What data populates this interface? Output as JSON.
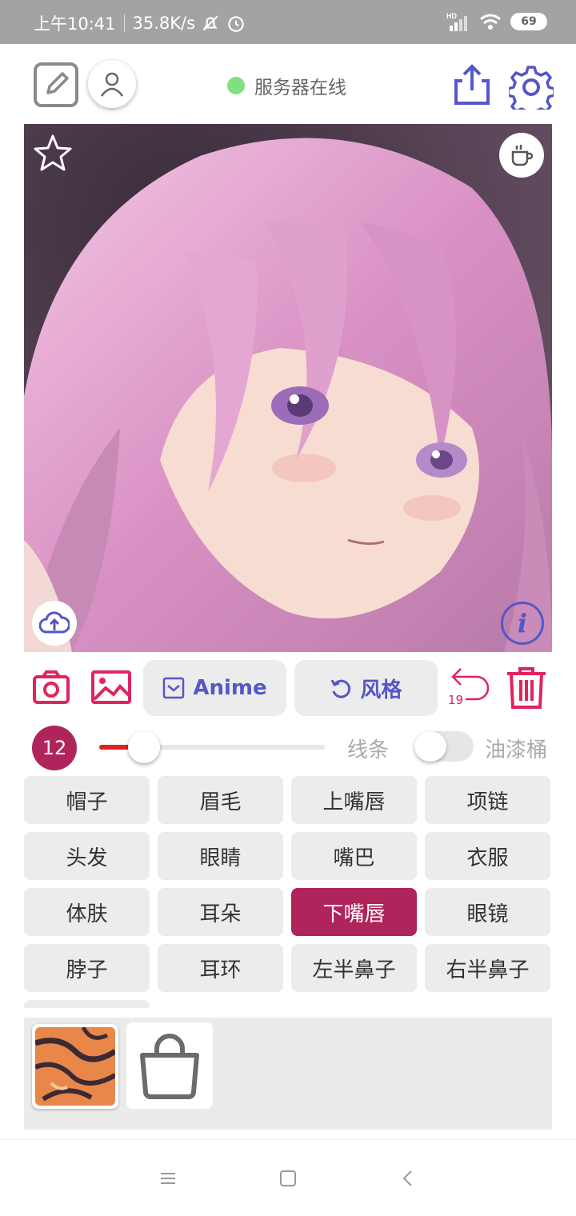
{
  "status_bar": {
    "time": "上午10:41",
    "network_speed": "35.8K/s",
    "battery": "69",
    "signal_label": "HD"
  },
  "header": {
    "server_status": "服务器在线",
    "status_color": "#7fe07f"
  },
  "canvas": {
    "info_glyph": "i"
  },
  "actions": {
    "anime_label": "Anime",
    "style_label": "风格",
    "undo_count": "19"
  },
  "brush": {
    "size": "12",
    "slider_fraction": 0.2,
    "line_label": "线条",
    "bucket_label": "油漆桶",
    "bucket_enabled": false
  },
  "labels": [
    {
      "text": "帽子",
      "selected": false
    },
    {
      "text": "眉毛",
      "selected": false
    },
    {
      "text": "上嘴唇",
      "selected": false
    },
    {
      "text": "项链",
      "selected": false
    },
    {
      "text": "头发",
      "selected": false
    },
    {
      "text": "眼睛",
      "selected": false
    },
    {
      "text": "嘴巴",
      "selected": false
    },
    {
      "text": "衣服",
      "selected": false
    },
    {
      "text": "体肤",
      "selected": false
    },
    {
      "text": "耳朵",
      "selected": false
    },
    {
      "text": "下嘴唇",
      "selected": true
    },
    {
      "text": "眼镜",
      "selected": false
    },
    {
      "text": "脖子",
      "selected": false
    },
    {
      "text": "耳环",
      "selected": false
    },
    {
      "text": "左半鼻子",
      "selected": false
    },
    {
      "text": "右半鼻子",
      "selected": false
    },
    {
      "text": "",
      "selected": false
    }
  ],
  "colors": {
    "accent": "#5556c8",
    "selected": "#b0245c",
    "danger": "#e0245e",
    "slider": "#e02020"
  }
}
